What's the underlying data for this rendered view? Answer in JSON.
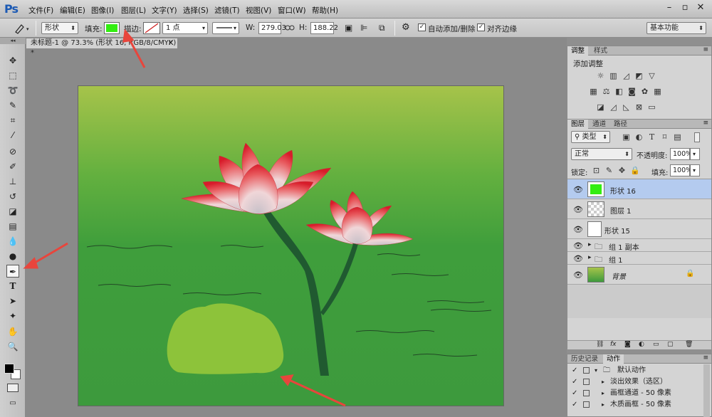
{
  "app": {
    "logo": "Ps"
  },
  "menu": [
    "文件(F)",
    "编辑(E)",
    "图像(I)",
    "图层(L)",
    "文字(Y)",
    "选择(S)",
    "滤镜(T)",
    "视图(V)",
    "窗口(W)",
    "帮助(H)"
  ],
  "window_controls": {
    "minimize": "–",
    "restore": "▫",
    "close": "✕"
  },
  "options": {
    "mode_value": "形状",
    "fill_label": "填充:",
    "fill_color": "#33ee11",
    "stroke_label": "描边:",
    "stroke_size": "1 点",
    "w_label": "W:",
    "w_value": "279.03",
    "h_label": "H:",
    "h_value": "188.22",
    "auto_add_delete": "自动添加/删除",
    "align_edges": "对齐边缘",
    "workspace": "基本功能"
  },
  "document": {
    "tab_title": "未标题-1 @ 73.3% (形状 16, RGB/8/CMYK) *",
    "close": "×"
  },
  "tools": [
    "move-tool",
    "marquee-tool",
    "lasso-tool",
    "quick-select-tool",
    "crop-tool",
    "eyedropper-tool",
    "healing-tool",
    "brush-tool",
    "stamp-tool",
    "history-brush-tool",
    "eraser-tool",
    "gradient-tool",
    "blur-tool",
    "dodge-tool",
    "pen-tool",
    "type-tool",
    "path-select-tool",
    "shape-tool",
    "hand-tool",
    "zoom-tool"
  ],
  "adjustments": {
    "tabs": [
      "调整",
      "样式"
    ],
    "title": "添加调整"
  },
  "layers": {
    "tabs": [
      "图层",
      "通道",
      "路径"
    ],
    "filter_label": "类型",
    "blend_mode": "正常",
    "opacity_label": "不透明度:",
    "opacity_value": "100%",
    "lock_label": "锁定:",
    "fill_label": "填充:",
    "fill_value": "100%",
    "items": [
      {
        "name": "形状 16",
        "selected": true
      },
      {
        "name": "图层 1"
      },
      {
        "name": "形状 15"
      },
      {
        "name": "组 1 副本"
      },
      {
        "name": "组 1"
      },
      {
        "name": "背景"
      }
    ]
  },
  "history": {
    "tabs": [
      "历史记录",
      "动作"
    ],
    "items": [
      "默认动作",
      "淡出效果（选区）",
      "画框通道 - 50 像素",
      "木质画框 - 50 像素"
    ]
  }
}
